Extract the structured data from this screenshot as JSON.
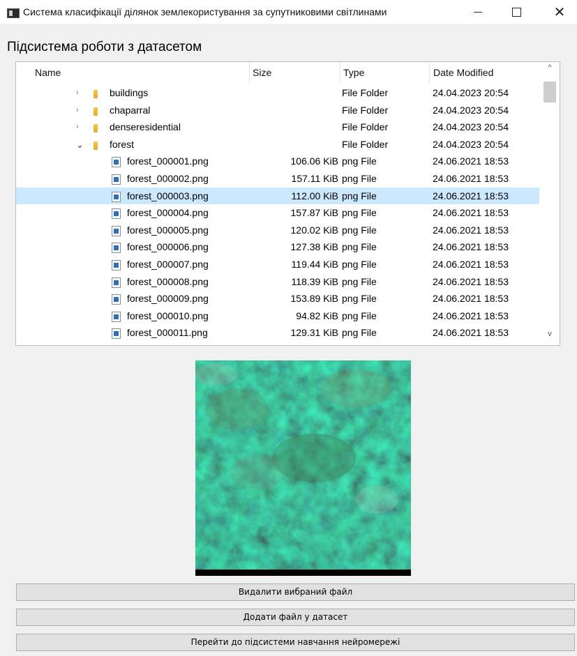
{
  "window": {
    "title": "Система класифікації ділянок землекористування за супутниковими світлинами",
    "minimize": "—",
    "maximize": "☐",
    "close": "✕"
  },
  "heading": "Підсистема роботи з датасетом",
  "tree": {
    "columns": [
      "Name",
      "Size",
      "Type",
      "Date Modified"
    ],
    "rows": [
      {
        "kind": "folder",
        "expanded": false,
        "name": "buildings",
        "size": "",
        "type": "File Folder",
        "date": "24.04.2023 20:54"
      },
      {
        "kind": "folder",
        "expanded": false,
        "name": "chaparral",
        "size": "",
        "type": "File Folder",
        "date": "24.04.2023 20:54"
      },
      {
        "kind": "folder",
        "expanded": false,
        "name": "denseresidential",
        "size": "",
        "type": "File Folder",
        "date": "24.04.2023 20:54"
      },
      {
        "kind": "folder",
        "expanded": true,
        "name": "forest",
        "size": "",
        "type": "File Folder",
        "date": "24.04.2023 20:54"
      },
      {
        "kind": "file",
        "name": "forest_000001.png",
        "size": "106.06 KiB",
        "type": "png File",
        "date": "24.06.2021 18:53"
      },
      {
        "kind": "file",
        "name": "forest_000002.png",
        "size": "157.11 KiB",
        "type": "png File",
        "date": "24.06.2021 18:53"
      },
      {
        "kind": "file",
        "selected": true,
        "name": "forest_000003.png",
        "size": "112.00 KiB",
        "type": "png File",
        "date": "24.06.2021 18:53"
      },
      {
        "kind": "file",
        "name": "forest_000004.png",
        "size": "157.87 KiB",
        "type": "png File",
        "date": "24.06.2021 18:53"
      },
      {
        "kind": "file",
        "name": "forest_000005.png",
        "size": "120.02 KiB",
        "type": "png File",
        "date": "24.06.2021 18:53"
      },
      {
        "kind": "file",
        "name": "forest_000006.png",
        "size": "127.38 KiB",
        "type": "png File",
        "date": "24.06.2021 18:53"
      },
      {
        "kind": "file",
        "name": "forest_000007.png",
        "size": "119.44 KiB",
        "type": "png File",
        "date": "24.06.2021 18:53"
      },
      {
        "kind": "file",
        "name": "forest_000008.png",
        "size": "118.39 KiB",
        "type": "png File",
        "date": "24.06.2021 18:53"
      },
      {
        "kind": "file",
        "name": "forest_000009.png",
        "size": "153.89 KiB",
        "type": "png File",
        "date": "24.06.2021 18:53"
      },
      {
        "kind": "file",
        "name": "forest_000010.png",
        "size": "94.82 KiB",
        "type": "png File",
        "date": "24.06.2021 18:53"
      },
      {
        "kind": "file",
        "name": "forest_000011.png",
        "size": "129.31 KiB",
        "type": "png File",
        "date": "24.06.2021 18:53"
      }
    ],
    "scroll_up": "^",
    "scroll_down": "v"
  },
  "preview": {
    "description_icon": "satellite-image-forest"
  },
  "buttons": {
    "delete": "Видалити вибраний файл",
    "add": "Додати файл у датасет",
    "go_training": "Перейти до підсистеми навчання нейромережі"
  },
  "colors": {
    "selection": "#cce8ff",
    "folder": "#e5ad2b",
    "button_bg": "#e1e1e1"
  }
}
